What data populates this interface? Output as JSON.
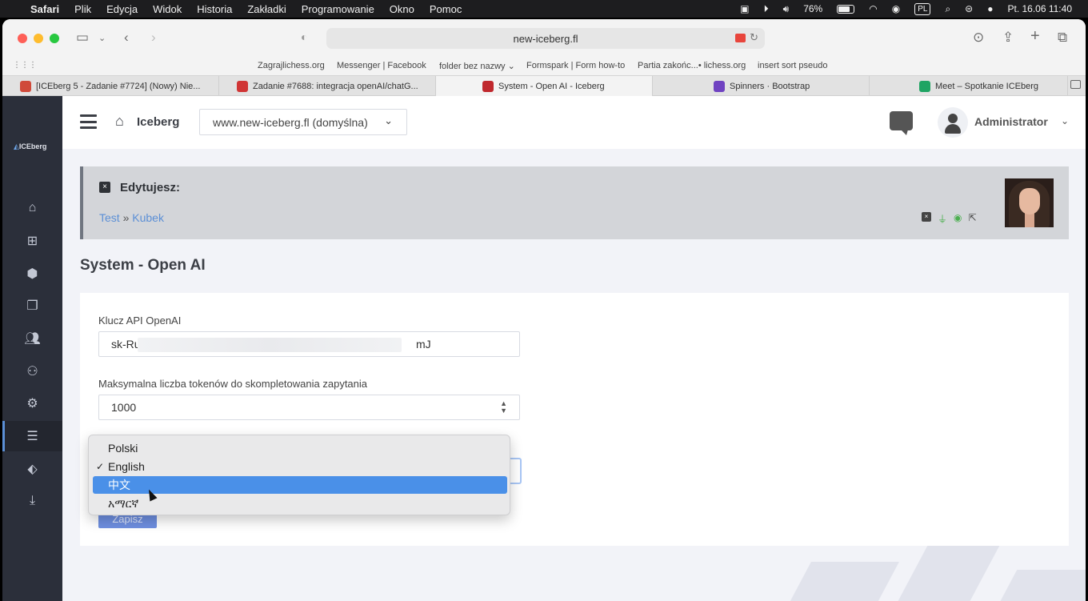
{
  "os_menubar": {
    "app": "Safari",
    "menus": [
      "Plik",
      "Edycja",
      "Widok",
      "Historia",
      "Zakładki",
      "Programowanie",
      "Okno",
      "Pomoc"
    ],
    "battery": "76%",
    "input_lang": "PL",
    "datetime": "Pt. 16.06  11:40"
  },
  "browser": {
    "url": "new-iceberg.fl",
    "bookmarks": [
      "Zagrajlichess.org",
      "Messenger | Facebook",
      "folder bez nazwy ⌄",
      "Formspark | Form how-to",
      "Partia zakońc...• lichess.org",
      "insert sort pseudo"
    ],
    "tabs": [
      {
        "title": "[ICEberg 5 - Zadanie #7724] (Nowy) Nie...",
        "favicon_color": "#d04a3a"
      },
      {
        "title": "Zadanie #7688: integracja openAI/chatG...",
        "favicon_color": "#d03535"
      },
      {
        "title": "System - Open AI - Iceberg",
        "favicon_color": "#c0282d"
      },
      {
        "title": "Spinners · Bootstrap",
        "favicon_color": "#6f42c1"
      },
      {
        "title": "Meet – Spotkanie ICEberg",
        "favicon_color": "#1fa463"
      }
    ]
  },
  "app": {
    "logo_text": "ICEberg",
    "brand": "Iceberg",
    "site_select": "www.new-iceberg.fl (domyślna)",
    "user": "Administrator",
    "sidebar_icons": [
      "home-icon",
      "sitemap-icon",
      "cubes-icon",
      "copy-icon",
      "users-icon",
      "user-group-icon",
      "gear-icon",
      "server-icon",
      "tags-icon",
      "download-icon"
    ],
    "accent": "#5b8fd6"
  },
  "editing": {
    "title": "Edytujesz:",
    "breadcrumb": [
      "Test",
      "Kubek"
    ],
    "separator": "»"
  },
  "page_title": "System - Open AI",
  "form": {
    "api_key_label": "Klucz API OpenAI",
    "api_key_start": "sk-Ru",
    "api_key_end": "mJ",
    "tokens_label": "Maksymalna liczba tokenów do skompletowania zapytania",
    "tokens_value": "1000",
    "save_label": "Zapisz"
  },
  "language_dropdown": {
    "options": [
      "Polski",
      "English",
      "中文",
      "አማርኛ"
    ],
    "checked": "English",
    "highlighted": "中文"
  }
}
